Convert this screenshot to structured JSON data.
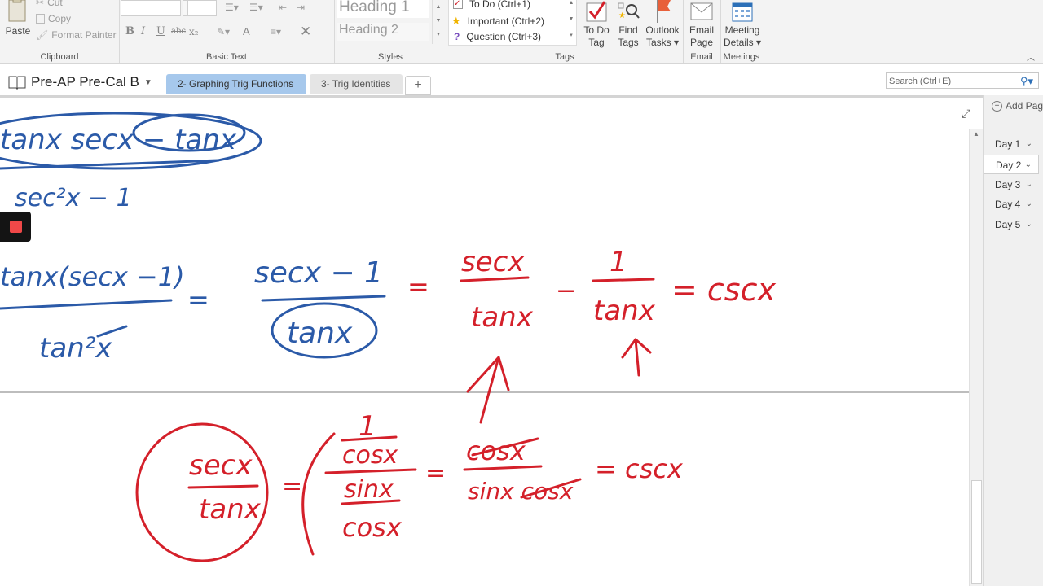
{
  "ribbon": {
    "clipboard": {
      "paste": "Paste",
      "cut": "Cut",
      "copy": "Copy",
      "format_painter": "Format Painter",
      "label": "Clipboard"
    },
    "basic_text": {
      "label": "Basic Text",
      "bold": "B",
      "italic": "I",
      "underline": "U",
      "strike": "abc",
      "subscript": "x₂",
      "font_color": "A",
      "clear": "✕"
    },
    "styles": {
      "heading1": "Heading 1",
      "heading2": "Heading 2",
      "label": "Styles"
    },
    "tags": {
      "todo": "To Do (Ctrl+1)",
      "important": "Important (Ctrl+2)",
      "question": "Question (Ctrl+3)",
      "label": "Tags",
      "todo_tag_l1": "To Do",
      "todo_tag_l2": "Tag",
      "find_tags_l1": "Find",
      "find_tags_l2": "Tags",
      "outlook_l1": "Outlook",
      "outlook_l2": "Tasks ▾"
    },
    "email": {
      "l1": "Email",
      "l2": "Page",
      "label": "Email"
    },
    "meetings": {
      "l1": "Meeting",
      "l2": "Details ▾",
      "label": "Meetings"
    }
  },
  "tabbar": {
    "notebook": "Pre-AP Pre-Cal B",
    "tabs": [
      {
        "label": "2- Graphing Trig Functions"
      },
      {
        "label": "3- Trig Identities"
      }
    ],
    "add_tab": "+",
    "search_placeholder": "Search (Ctrl+E)"
  },
  "pages_pane": {
    "add_page": "Add Page",
    "pages": [
      {
        "label": "Day 1"
      },
      {
        "label": "Day 2"
      },
      {
        "label": "Day 3"
      },
      {
        "label": "Day 4"
      },
      {
        "label": "Day 5"
      }
    ],
    "active_page": "Day 2"
  },
  "ink": {
    "colors": {
      "blue": "#2b5aa8",
      "red": "#d4202a"
    },
    "blue_texts": [
      "tanx secx − tanx",
      "sec²x − 1",
      "tanx(secx −1)",
      "=",
      "tan²x",
      "secx − 1",
      "tanx"
    ],
    "red_texts": [
      "=",
      "secx",
      "tanx",
      "−",
      "1",
      "tanx",
      "= cscx",
      "secx",
      "tanx",
      "=",
      "1",
      "cosx",
      "sinx",
      "cosx",
      "=",
      "cosx",
      "sinx cosx",
      "= cscx"
    ]
  }
}
